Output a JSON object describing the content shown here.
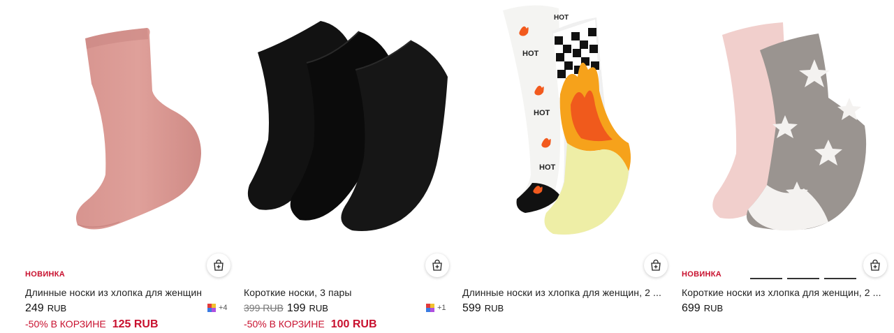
{
  "products": [
    {
      "badge": "НОВИНКА",
      "title": "Длинные носки из хлопка для женщин",
      "price": "249",
      "currency": "RUB",
      "promo_text": "-50% В КОРЗИНЕ",
      "promo_price": "125 RUB",
      "colors_more": "+4",
      "image_icon": "pink-sock-image"
    },
    {
      "title": "Короткие носки, 3 пары",
      "old_price": "399 RUB",
      "price": "199",
      "currency": "RUB",
      "promo_text": "-50% В КОРЗИНЕ",
      "promo_price": "100 RUB",
      "colors_more": "+1",
      "image_icon": "black-socks-image"
    },
    {
      "title": "Длинные носки из хлопка для женщин, 2 ...",
      "price": "599",
      "currency": "RUB",
      "image_icon": "flame-socks-image",
      "image_texts": [
        "HOT",
        "HOT",
        "HOT",
        "HOT"
      ]
    },
    {
      "badge": "НОВИНКА",
      "title": "Короткие носки из хлопка для женщин, 2 ...",
      "price": "699",
      "currency": "RUB",
      "image_icon": "star-fuzzy-socks-image"
    }
  ],
  "icons": {
    "cart": "add-to-cart-icon",
    "colors": "color-swatch-icon"
  },
  "colors": {
    "accent_red": "#c8102e",
    "text": "#222222",
    "muted": "#777777"
  }
}
